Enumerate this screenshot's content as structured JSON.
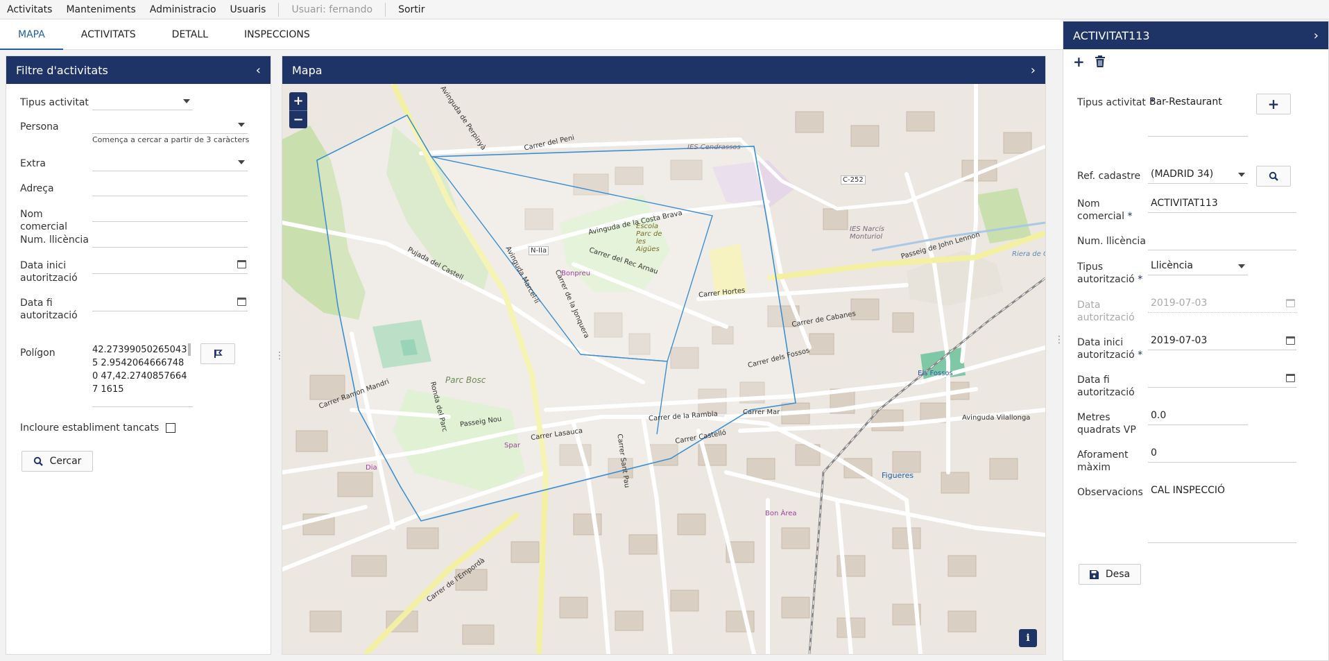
{
  "menu": {
    "items": [
      "Activitats",
      "Manteniments",
      "Administracio",
      "Usuaris"
    ],
    "user": "Usuari: fernando",
    "logout": "Sortir"
  },
  "tabs": [
    "MAPA",
    "ACTIVITATS",
    "DETALL",
    "INSPECCIONS"
  ],
  "filter": {
    "title": "Filtre d'activitats",
    "tipus_label": "Tipus activitat",
    "persona_label": "Persona",
    "persona_hint": "Comença a cercar a partir de 3 caràcters",
    "extra_label": "Extra",
    "adreca_label": "Adreça",
    "nom_label": "Nom comercial",
    "llicencia_label": "Num. llicència",
    "data_inici_label": "Data inici autorització",
    "data_fi_label": "Data fi autorització",
    "poligon_label": "Polígon",
    "poligon_value": "42.27399050265043 5 2.95420646667480 47,42.27408576647 1615",
    "tancats_label": "Incloure establiment tancats",
    "cercar_label": "Cercar"
  },
  "map": {
    "title": "Mapa",
    "zoom_in": "+",
    "zoom_out": "−",
    "info": "i",
    "labels": {
      "parc_bosc": "Parc Bosc",
      "bonpreu": "Bonpreu",
      "escola": "Escola Parc de les Aigües",
      "ies_cendrassos": "IES Cendrassos",
      "ies_narcis": "IES Narcís Monturiol",
      "figueres": "Figueres",
      "els_fossos": "Els Fossos",
      "dia": "Dia",
      "spar": "Spar",
      "bon_area": "Bon Àrea",
      "c252": "C-252",
      "n2a": "N-IIa",
      "riera": "Riera de G",
      "costa_brava": "Avinguda de la Costa Brava",
      "rambla": "Carrer de la Rambla",
      "vilallonga": "Avinguda Vilallonga",
      "emporda": "Carrer de l'Empordà",
      "perpinya": "Avinguda de Perpinyà",
      "marti": "Avinguda Marcel·lí",
      "passeig_nou": "Passeig Nou",
      "john_lennon": "Passeig de John Lennon",
      "castell": "Pujada del Castell",
      "jonquera": "Carrer de la Jonquera",
      "ronda": "Ronda del Parc",
      "sant_pau": "Carrer Sant Pau",
      "lasauca": "Carrer Lasauca",
      "rec_arnau": "Carrer del Rec Arnau",
      "peni": "Carrer del Peni",
      "hortes": "Carrer Hortes",
      "fossos": "Carrer dels Fossos",
      "cabanes": "Carrer de Cabanes",
      "ramon_mandri": "Carrer Ramon Mandri",
      "mar": "Carrer Mar",
      "castello": "Carrer Castelló"
    }
  },
  "detail": {
    "title": "ACTIVITAT113",
    "tipus_label": "Tipus activitat",
    "tipus_value": "Bar-Restaurant",
    "cadastre_label": "Ref. cadastre",
    "cadastre_value": "(MADRID 34)",
    "nom_label": "Nom comercial",
    "nom_value": "ACTIVITAT113",
    "llicencia_label": "Num. llicència",
    "llicencia_value": "",
    "tipus_aut_label": "Tipus autorització",
    "tipus_aut_value": "Llicència",
    "data_aut_label": "Data autorització",
    "data_aut_value": "2019-07-03",
    "data_inici_label": "Data inici autorització",
    "data_inici_value": "2019-07-03",
    "data_fi_label": "Data fi autorització",
    "data_fi_value": "",
    "metres_label": "Metres quadrats VP",
    "metres_value": "0.0",
    "aforament_label": "Aforament màxim",
    "aforament_value": "0",
    "observacions_label": "Observacions",
    "observacions_value": "CAL INSPECCIÓ",
    "desa_label": "Desa",
    "req": "*"
  },
  "colors": {
    "header": "#1e3366",
    "accent": "#1f5da8",
    "polygon": "#3b8fd1"
  }
}
